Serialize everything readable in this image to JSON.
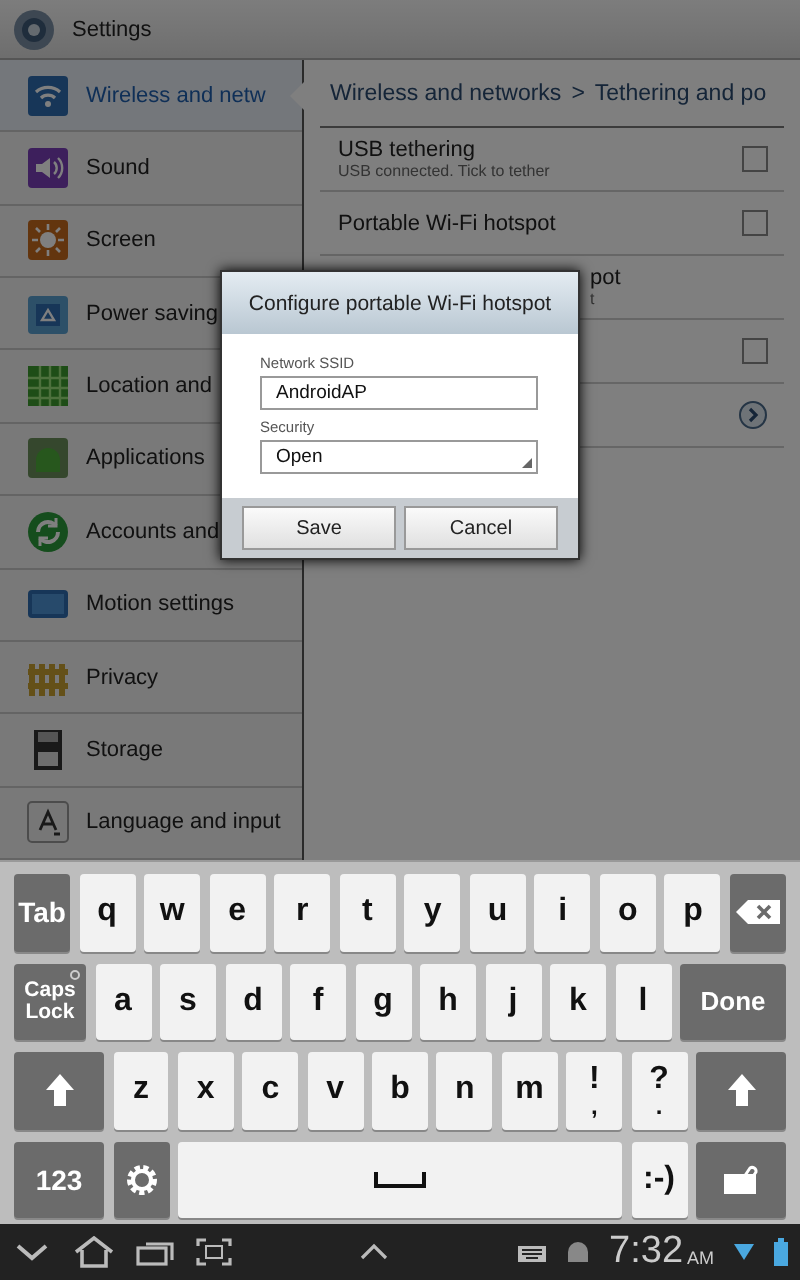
{
  "title_bar": {
    "title": "Settings"
  },
  "sidebar": {
    "items": [
      {
        "label": "Wireless and netw",
        "selected": true
      },
      {
        "label": "Sound",
        "selected": false
      },
      {
        "label": "Screen",
        "selected": false
      },
      {
        "label": "Power saving",
        "selected": false
      },
      {
        "label": "Location and",
        "selected": false
      },
      {
        "label": "Applications",
        "selected": false
      },
      {
        "label": "Accounts and",
        "selected": false
      },
      {
        "label": "Motion settings",
        "selected": false
      },
      {
        "label": "Privacy",
        "selected": false
      },
      {
        "label": "Storage",
        "selected": false
      },
      {
        "label": "Language and input",
        "selected": false
      }
    ]
  },
  "breadcrumb": {
    "parent": "Wireless and networks",
    "separator": ">",
    "current": "Tethering and po"
  },
  "rows": [
    {
      "kind": "checkbox",
      "title": "USB tethering",
      "subtitle": "USB connected. Tick to tether",
      "checked": false
    },
    {
      "kind": "checkbox",
      "title": "Portable Wi-Fi hotspot",
      "checked": false
    },
    {
      "kind": "fragment",
      "title": "pot",
      "subtitle": "t"
    },
    {
      "kind": "checkbox",
      "checked": false
    },
    {
      "kind": "link"
    }
  ],
  "dialog": {
    "title": "Configure portable Wi-Fi hotspot",
    "ssid_label": "Network SSID",
    "ssid_value": "AndroidAP",
    "security_label": "Security",
    "security_value": "Open",
    "buttons": [
      "Save",
      "Cancel"
    ]
  },
  "keyboard": {
    "rows": [
      [
        {
          "kind": "action",
          "label": "Tab"
        },
        {
          "kind": "char",
          "label": "q"
        },
        {
          "kind": "char",
          "label": "w"
        },
        {
          "kind": "char",
          "label": "e"
        },
        {
          "kind": "char",
          "label": "r"
        },
        {
          "kind": "char",
          "label": "t"
        },
        {
          "kind": "char",
          "label": "y"
        },
        {
          "kind": "char",
          "label": "u"
        },
        {
          "kind": "char",
          "label": "i"
        },
        {
          "kind": "char",
          "label": "o"
        },
        {
          "kind": "char",
          "label": "p"
        },
        {
          "kind": "backspace"
        }
      ],
      [
        {
          "kind": "caps",
          "label": "Caps Lock"
        },
        {
          "kind": "char",
          "label": "a"
        },
        {
          "kind": "char",
          "label": "s"
        },
        {
          "kind": "char",
          "label": "d"
        },
        {
          "kind": "char",
          "label": "f"
        },
        {
          "kind": "char",
          "label": "g"
        },
        {
          "kind": "char",
          "label": "h"
        },
        {
          "kind": "char",
          "label": "j"
        },
        {
          "kind": "char",
          "label": "k"
        },
        {
          "kind": "char",
          "label": "l"
        },
        {
          "kind": "action",
          "label": "Done"
        }
      ],
      [
        {
          "kind": "shift"
        },
        {
          "kind": "char",
          "label": "z"
        },
        {
          "kind": "char",
          "label": "x"
        },
        {
          "kind": "char",
          "label": "c"
        },
        {
          "kind": "char",
          "label": "v"
        },
        {
          "kind": "char",
          "label": "b"
        },
        {
          "kind": "char",
          "label": "n"
        },
        {
          "kind": "char",
          "label": "m"
        },
        {
          "kind": "dual",
          "label": "!",
          "sub": ","
        },
        {
          "kind": "dual",
          "label": "?",
          "sub": "."
        },
        {
          "kind": "shift"
        }
      ],
      [
        {
          "kind": "action",
          "label": "123"
        },
        {
          "kind": "settings"
        },
        {
          "kind": "space"
        },
        {
          "kind": "char",
          "label": ":-)"
        },
        {
          "kind": "clip"
        }
      ]
    ]
  },
  "status_bar": {
    "time": "7:32",
    "meridiem": "AM"
  }
}
